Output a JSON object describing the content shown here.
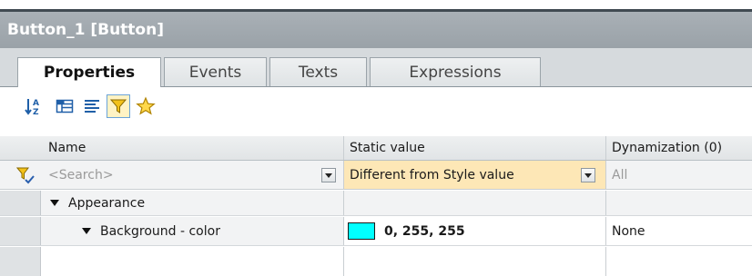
{
  "window": {
    "title": "Button_1 [Button]"
  },
  "tabs": [
    {
      "label": "Properties"
    },
    {
      "label": "Events"
    },
    {
      "label": "Texts"
    },
    {
      "label": "Expressions"
    }
  ],
  "toolbar": {
    "icons": [
      "sort-alphabetical-icon",
      "group-categories-icon",
      "list-view-icon",
      "filter-icon",
      "favorites-star-icon"
    ]
  },
  "grid": {
    "columns": {
      "name": "Name",
      "static_value": "Static value",
      "dynamization": "Dynamization (0)"
    },
    "filter_row": {
      "search_placeholder": "<Search>",
      "static_filter": "Different from Style value",
      "dynamization_filter": "All"
    },
    "rows": [
      {
        "name": "Appearance",
        "static_value": "",
        "dynamization": ""
      },
      {
        "name": "Background - color",
        "static_value": "0, 255, 255",
        "dynamization": "None",
        "color": "#00ffff"
      }
    ]
  },
  "colors": {
    "title_bar": "#9fa7ad",
    "filter_highlight": "#fde7b6",
    "swatch": "#00ffff"
  }
}
